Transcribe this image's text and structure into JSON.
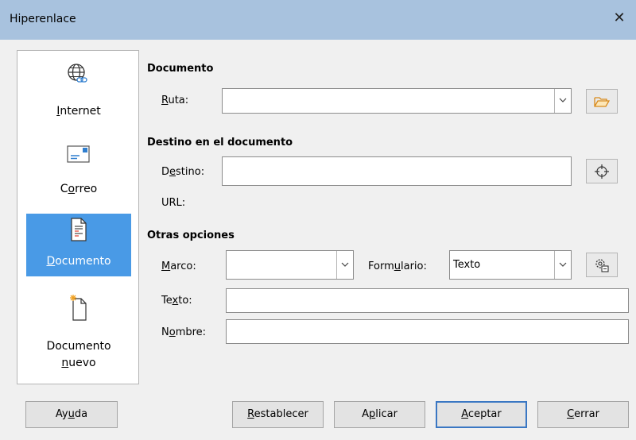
{
  "window": {
    "title": "Hiperenlace",
    "close_glyph": "✕"
  },
  "sidebar": {
    "items": [
      {
        "pre": "",
        "ul": "I",
        "post": "nternet",
        "icon": "globe-link-icon"
      },
      {
        "pre": "C",
        "ul": "o",
        "post": "rreo",
        "icon": "envelope-icon"
      },
      {
        "pre": "",
        "ul": "D",
        "post": "ocumento",
        "icon": "document-icon",
        "selected": true
      },
      {
        "line1": "Documento",
        "pre": "",
        "ul": "n",
        "post": "uevo",
        "icon": "new-document-icon"
      }
    ]
  },
  "documento": {
    "heading": "Documento",
    "ruta_pre": "",
    "ruta_ul": "R",
    "ruta_post": "uta:",
    "ruta_value": ""
  },
  "destino": {
    "heading": "Destino en el documento",
    "destino_pre": "D",
    "destino_ul": "e",
    "destino_post": "stino:",
    "destino_value": "",
    "url_label": "URL:"
  },
  "otras": {
    "heading": "Otras opciones",
    "marco_pre": "",
    "marco_ul": "M",
    "marco_post": "arco:",
    "marco_value": "",
    "formulario_pre": "Form",
    "formulario_ul": "u",
    "formulario_post": "lario:",
    "formulario_value": "Texto",
    "texto_pre": "Te",
    "texto_ul": "x",
    "texto_post": "to:",
    "texto_value": "",
    "nombre_pre": "N",
    "nombre_ul": "o",
    "nombre_post": "mbre:",
    "nombre_value": ""
  },
  "buttons": {
    "ayuda": {
      "pre": "Ay",
      "ul": "u",
      "post": "da"
    },
    "restablecer": {
      "pre": "",
      "ul": "R",
      "post": "establecer"
    },
    "aplicar": {
      "pre": "A",
      "ul": "p",
      "post": "licar"
    },
    "aceptar": {
      "pre": "",
      "ul": "A",
      "post": "ceptar"
    },
    "cerrar": {
      "pre": "",
      "ul": "C",
      "post": "errar"
    }
  }
}
